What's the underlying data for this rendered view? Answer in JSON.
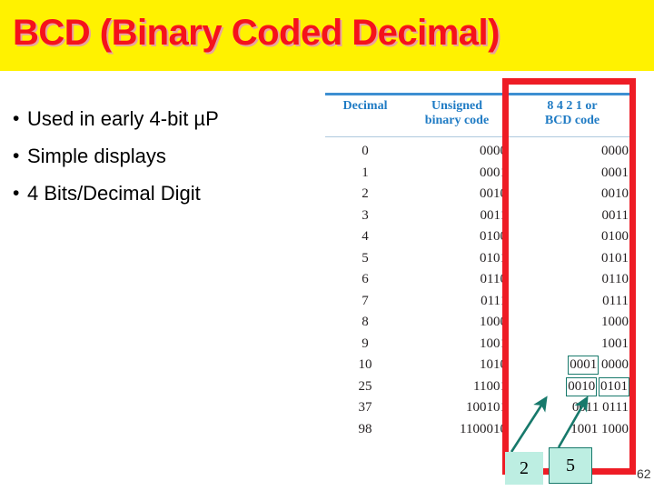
{
  "slide": {
    "title": "BCD (Binary Coded Decimal)",
    "page_number": "62",
    "colors": {
      "banner_background": "#FFF200",
      "title_text": "#F5121B",
      "title_shadow": "#E8A2A0",
      "table_header_text": "#1F7BC4",
      "table_rule": "#3D8FD1",
      "table_rule_light": "#AFC9DE",
      "highlight_rect": "#EE1C25",
      "callout_fill": "#BDEEE2",
      "callout_border": "#17796B",
      "arrow": "#17796B",
      "body_text": "#000000"
    }
  },
  "bullets": [
    {
      "marker": "•",
      "label": "Used in early 4-bit µP"
    },
    {
      "marker": "•",
      "label": "Simple displays"
    },
    {
      "marker": "•",
      "label": "4 Bits/Decimal Digit"
    }
  ],
  "table": {
    "headers": {
      "decimal": "Decimal",
      "unsigned_line1": "Unsigned",
      "unsigned_line2": "binary code",
      "bcd_line1": "8 4 2 1 or",
      "bcd_line2": "BCD code"
    },
    "rows": [
      {
        "decimal": "0",
        "binary": "0000",
        "bcd_groups": [
          {
            "text": "0000",
            "boxed": false
          }
        ]
      },
      {
        "decimal": "1",
        "binary": "0001",
        "bcd_groups": [
          {
            "text": "0001",
            "boxed": false
          }
        ]
      },
      {
        "decimal": "2",
        "binary": "0010",
        "bcd_groups": [
          {
            "text": "0010",
            "boxed": false
          }
        ]
      },
      {
        "decimal": "3",
        "binary": "0011",
        "bcd_groups": [
          {
            "text": "0011",
            "boxed": false
          }
        ]
      },
      {
        "decimal": "4",
        "binary": "0100",
        "bcd_groups": [
          {
            "text": "0100",
            "boxed": false
          }
        ]
      },
      {
        "decimal": "5",
        "binary": "0101",
        "bcd_groups": [
          {
            "text": "0101",
            "boxed": false
          }
        ]
      },
      {
        "decimal": "6",
        "binary": "0110",
        "bcd_groups": [
          {
            "text": "0110",
            "boxed": false
          }
        ]
      },
      {
        "decimal": "7",
        "binary": "0111",
        "bcd_groups": [
          {
            "text": "0111",
            "boxed": false
          }
        ]
      },
      {
        "decimal": "8",
        "binary": "1000",
        "bcd_groups": [
          {
            "text": "1000",
            "boxed": false
          }
        ]
      },
      {
        "decimal": "9",
        "binary": "1001",
        "bcd_groups": [
          {
            "text": "1001",
            "boxed": false
          }
        ]
      },
      {
        "decimal": "10",
        "binary": "1010",
        "bcd_groups": [
          {
            "text": "0001",
            "boxed": true
          },
          {
            "text": "0000",
            "boxed": false
          }
        ]
      },
      {
        "decimal": "25",
        "binary": "11001",
        "bcd_groups": [
          {
            "text": "0010",
            "boxed": true
          },
          {
            "text": "0101",
            "boxed": true
          }
        ]
      },
      {
        "decimal": "37",
        "binary": "100101",
        "bcd_groups": [
          {
            "text": "0011",
            "boxed": false
          },
          {
            "text": "0111",
            "boxed": false
          }
        ]
      },
      {
        "decimal": "98",
        "binary": "1100010",
        "bcd_groups": [
          {
            "text": "1001",
            "boxed": false
          },
          {
            "text": "1000",
            "boxed": false
          }
        ]
      }
    ]
  },
  "callouts": [
    {
      "id": "tens-digit",
      "label": "2"
    },
    {
      "id": "units-digit",
      "label": "5"
    }
  ]
}
